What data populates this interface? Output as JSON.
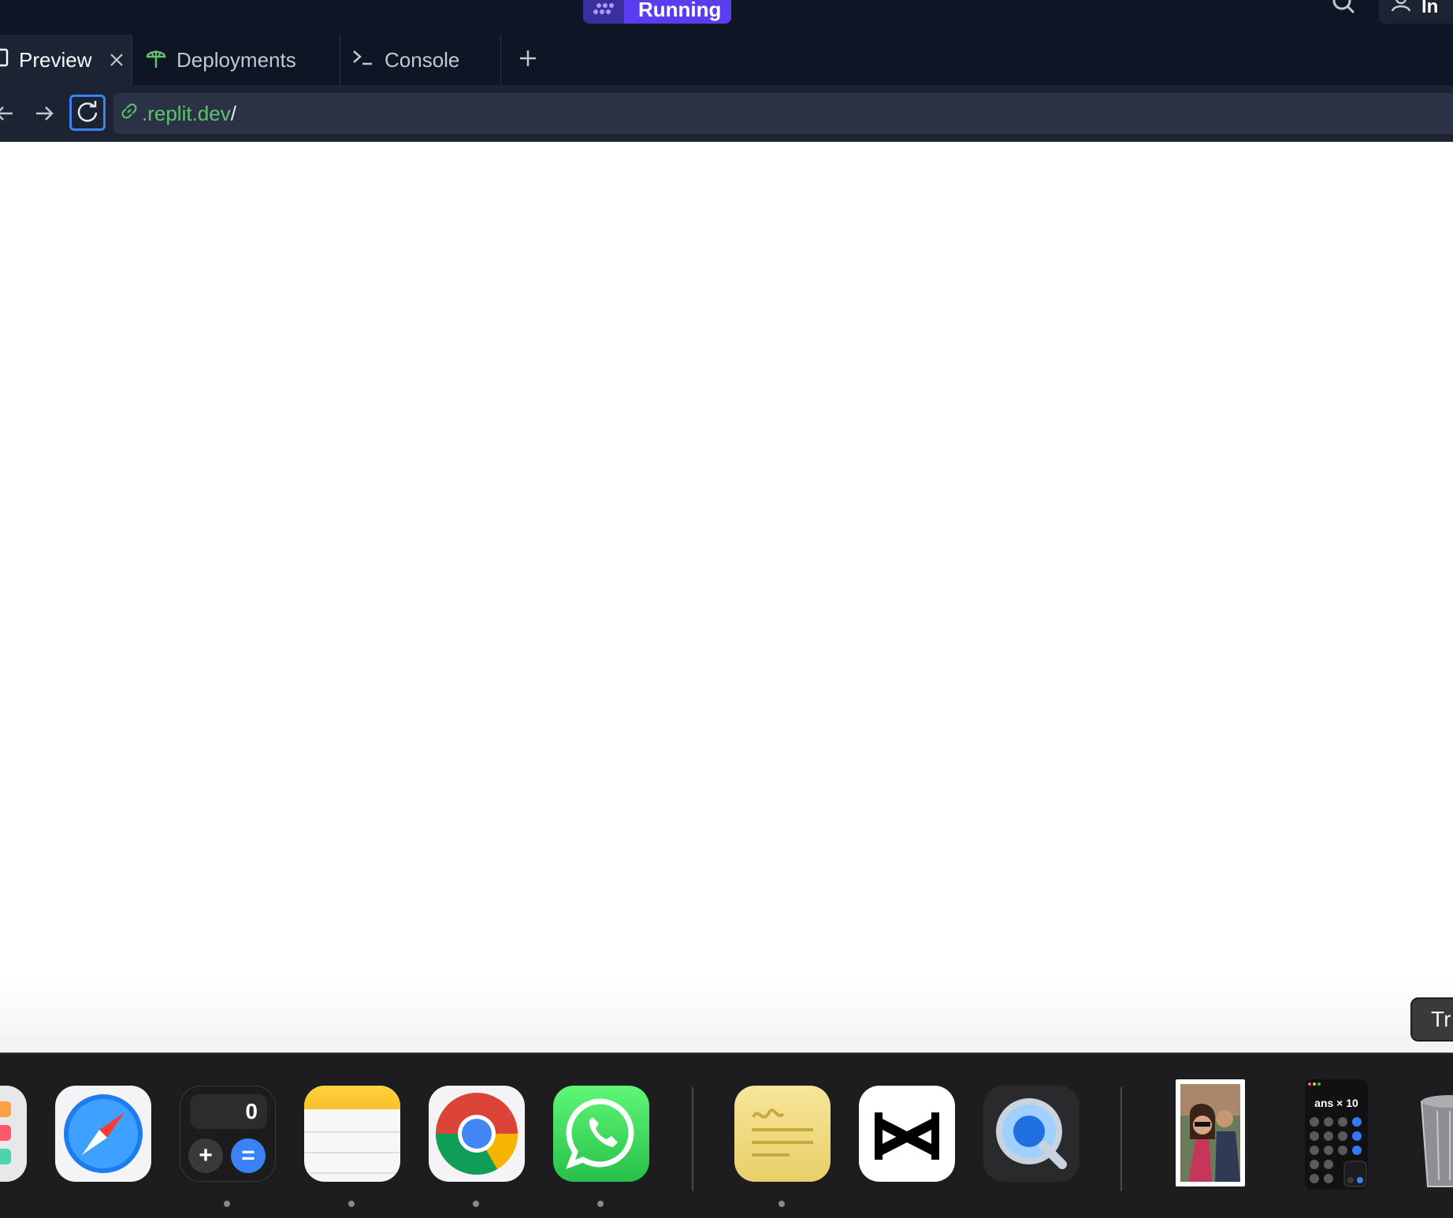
{
  "header": {
    "run_button": "Running",
    "user_label": "In"
  },
  "tabs": [
    {
      "label": "Preview",
      "icon": "preview-icon",
      "active": true
    },
    {
      "label": "Deployments",
      "icon": "deployments-icon",
      "active": false
    },
    {
      "label": "Console",
      "icon": "console-icon",
      "active": false
    }
  ],
  "address_bar": {
    "host": ".replit.dev",
    "path": "/"
  },
  "tooltip": {
    "text": "Tr"
  },
  "dock": {
    "apps": [
      {
        "name": "launchpad",
        "running": false
      },
      {
        "name": "safari",
        "running": false
      },
      {
        "name": "calculator",
        "running": true
      },
      {
        "name": "notes",
        "running": true
      },
      {
        "name": "chrome",
        "running": true
      },
      {
        "name": "whatsapp",
        "running": true
      },
      {
        "name": "stickies",
        "running": true
      },
      {
        "name": "capcut",
        "running": false
      },
      {
        "name": "quicktime",
        "running": false
      }
    ],
    "calculator_display": "0",
    "calculator_plus": "+",
    "calculator_equals": "=",
    "recent_screenshot_text": "ans × 10"
  },
  "colors": {
    "header_bg": "#0e1525",
    "addressbar_bg": "#1c2333",
    "run_accent": "#5b3df0",
    "url_host": "#5ec36c",
    "focus_ring": "#3b82f6"
  }
}
